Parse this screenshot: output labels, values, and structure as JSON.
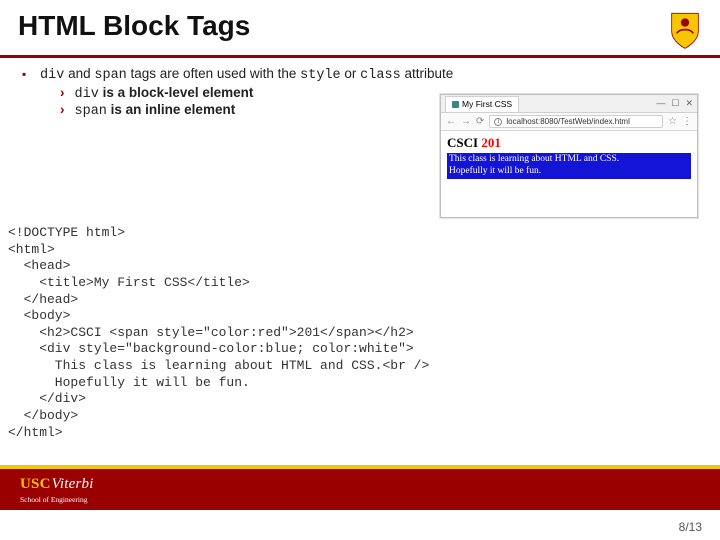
{
  "header": {
    "title": "HTML Block Tags"
  },
  "bullets": {
    "top_pre": "",
    "top_code1": "div",
    "top_mid1": " and ",
    "top_code2": "span",
    "top_mid2": " tags are often used with the ",
    "top_code3": "style",
    "top_mid3": " or ",
    "top_code4": "class",
    "top_post": " attribute",
    "sub1_code": "div",
    "sub1_rest": " is a block-level element",
    "sub2_code": "span",
    "sub2_rest": " is an inline element"
  },
  "browser": {
    "tab_label": "My First CSS",
    "win_min": "—",
    "win_max": "☐",
    "win_close": "✕",
    "nav_back": "←",
    "nav_fwd": "→",
    "nav_reload": "⟳",
    "url": "localhost:8080/TestWeb/index.html",
    "star": "☆",
    "menu": "⋮",
    "page": {
      "h2_a": "CSCI ",
      "h2_b": "201",
      "line1": "This class is learning about HTML and CSS.",
      "line2": "Hopefully it will be fun."
    }
  },
  "code": {
    "l01": "<!DOCTYPE html>",
    "l02": "<html>",
    "l03": "  <head>",
    "l04": "    <title>My First CSS</title>",
    "l05": "  </head>",
    "l06": "  <body>",
    "l07": "    <h2>CSCI <span style=\"color:red\">201</span></h2>",
    "l08": "    <div style=\"background-color:blue; color:white\">",
    "l09": "      This class is learning about HTML and CSS.<br />",
    "l10": "      Hopefully it will be fun.",
    "l11": "    </div>",
    "l12": "  </body>",
    "l13": "</html>"
  },
  "footer": {
    "usc": "USC",
    "viterbi": "Viterbi",
    "school": "School of Engineering",
    "page": "8/13"
  }
}
